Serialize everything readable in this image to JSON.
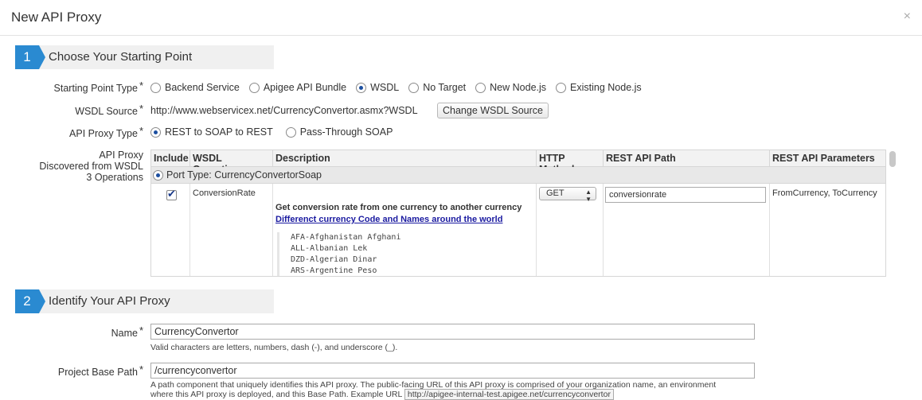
{
  "dialog": {
    "title": "New API Proxy",
    "close_symbol": "×"
  },
  "step1": {
    "number": "1",
    "title": "Choose Your Starting Point",
    "starting_point_label": "Starting Point Type",
    "required_mark": "*",
    "starting_point_options": [
      {
        "label": "Backend Service",
        "selected": false
      },
      {
        "label": "Apigee API Bundle",
        "selected": false
      },
      {
        "label": "WSDL",
        "selected": true
      },
      {
        "label": "No Target",
        "selected": false
      },
      {
        "label": "New Node.js",
        "selected": false
      },
      {
        "label": "Existing Node.js",
        "selected": false
      }
    ],
    "wsdl_source_label": "WSDL Source",
    "wsdl_source_value": "http://www.webservicex.net/CurrencyConvertor.asmx?WSDL",
    "change_wsdl_button": "Change WSDL Source",
    "proxy_type_label": "API Proxy Type",
    "proxy_type_options": [
      {
        "label": "REST to SOAP to REST",
        "selected": true
      },
      {
        "label": "Pass-Through SOAP",
        "selected": false
      }
    ],
    "discovered_label_line1": "API Proxy",
    "discovered_label_line2": "Discovered from WSDL",
    "discovered_label_line3": "3 Operations",
    "grid": {
      "columns": [
        "Include",
        "WSDL Operation",
        "Description",
        "HTTP Method",
        "REST API Path",
        "REST API Parameters"
      ],
      "port_type": "Port Type: CurrencyConvertorSoap",
      "row": {
        "operation": "ConversionRate",
        "description": "Get conversion rate from one currency to another currency",
        "link": "Differenct currency Code and Names around the world",
        "currencies": [
          "AFA-Afghanistan Afghani",
          "ALL-Albanian Lek",
          "DZD-Algerian Dinar",
          "ARS-Argentine Peso"
        ],
        "http_method": "GET",
        "rest_path": "conversionrate",
        "rest_params": "FromCurrency, ToCurrency"
      }
    }
  },
  "step2": {
    "number": "2",
    "title": "Identify Your API Proxy",
    "name_label": "Name",
    "name_value": "CurrencyConvertor",
    "name_hint": "Valid characters are letters, numbers, dash (-), and underscore (_).",
    "base_path_label": "Project Base Path",
    "base_path_value": "/currencyconvertor",
    "base_path_hint1": "A path component that uniquely identifies this API proxy. The public-facing URL of this API proxy is comprised of your organization name, an environment",
    "base_path_hint2": "where this API proxy is deployed, and this Base Path. Example URL",
    "example_url": "http://apigee-internal-test.apigee.net/currencyconvertor"
  }
}
